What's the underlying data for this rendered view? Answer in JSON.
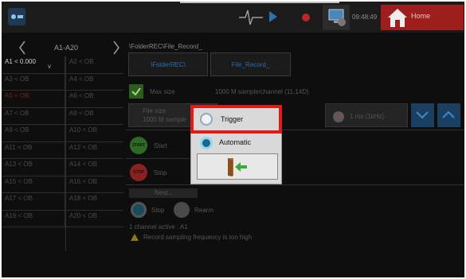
{
  "topbar": {
    "time": "09:48:49",
    "home_label": "Home"
  },
  "channels": {
    "range_label": "A1-A20",
    "rows": [
      {
        "left": "A1 < 0.000",
        "left_unit": "V",
        "right": "A2 < OB",
        "highlight": false
      },
      {
        "left": "A3 < OB",
        "right": "A4 < OB",
        "highlight": false
      },
      {
        "left": "A5 < OB",
        "right": "A6 < OB",
        "highlight": true
      },
      {
        "left": "A7 < OB",
        "right": "A8 < OB",
        "highlight": false
      },
      {
        "left": "A9 < OB",
        "right": "A10 < OB",
        "highlight": false
      },
      {
        "left": "A11 < OB",
        "right": "A12 < OB",
        "highlight": false
      },
      {
        "left": "A13 < OB",
        "right": "A14 < OB",
        "highlight": false
      },
      {
        "left": "A15 < OB",
        "right": "A16 < OB",
        "highlight": false
      },
      {
        "left": "A17 < OB",
        "right": "A18 < OB",
        "highlight": false
      },
      {
        "left": "A19 < OB",
        "right": "A20 < OB",
        "highlight": false
      }
    ]
  },
  "main": {
    "path": "\\FolderREC\\File_Record_",
    "folder_button": "\\FolderREC\\",
    "file_button": "File_Record_",
    "max_size_label": "Max size",
    "max_size_value": "1000 M sample/channel  (11.14D)",
    "file_size_label": "File size",
    "file_size_value": "1000 M sample",
    "rate_value": "1 ms (1kHz)",
    "start_label": "Start",
    "start_icon_text": "START",
    "stop_label": "Stop",
    "stop_icon_text": "STOP",
    "next_button": "Next...",
    "stop2_label": "Stop",
    "rearm_label": "Rearm",
    "channels_active": "1 channel active : A1",
    "warning": "Record sampling frequency is too high"
  },
  "popup": {
    "trigger_label": "Trigger",
    "automatic_label": "Automatic",
    "accent": "#e11a1a"
  }
}
